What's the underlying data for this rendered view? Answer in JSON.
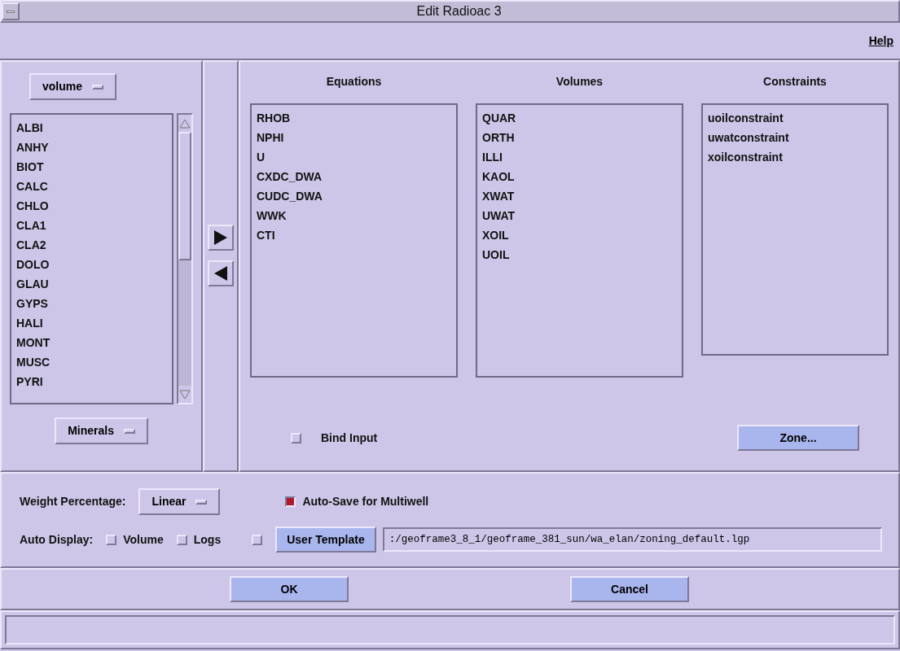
{
  "window": {
    "title": "Edit Radioac 3"
  },
  "menu": [
    {
      "label": "Help"
    }
  ],
  "left": {
    "type_menu": "volume",
    "items": [
      "ALBI",
      "ANHY",
      "BIOT",
      "CALC",
      "CHLO",
      "CLA1",
      "CLA2",
      "DOLO",
      "GLAU",
      "GYPS",
      "HALI",
      "MONT",
      "MUSC",
      "PYRI"
    ],
    "class_menu": "Minerals"
  },
  "transfer_buttons": [
    {
      "kind": "right"
    },
    {
      "kind": "left"
    }
  ],
  "lists": [
    {
      "title": "Equations",
      "items": [
        "RHOB",
        "NPHI",
        "U",
        "CXDC_DWA",
        "CUDC_DWA",
        "WWK",
        "CTI"
      ]
    },
    {
      "title": "Volumes",
      "items": [
        "QUAR",
        "ORTH",
        "ILLI",
        "KAOL",
        "XWAT",
        "UWAT",
        "XOIL",
        "UOIL"
      ]
    },
    {
      "title": "Constraints",
      "items": [
        "uoilconstraint",
        "uwatconstraint",
        "xoilconstraint"
      ]
    }
  ],
  "bind_input": {
    "label": "Bind Input",
    "checked": false
  },
  "zone_button": "Zone...",
  "weight": {
    "label": "Weight Percentage:",
    "value": "Linear"
  },
  "auto_save": {
    "label": "Auto-Save for Multiwell",
    "checked": true
  },
  "auto_display": {
    "label": "Auto Display:",
    "options": [
      {
        "label": "Volume",
        "checked": false
      },
      {
        "label": "Logs",
        "checked": false
      }
    ]
  },
  "user_template": {
    "checked": false,
    "button": "User Template",
    "path": ":/geoframe3_8_1/geoframe_381_sun/wa_elan/zoning_default.lgp"
  },
  "buttons": [
    "OK",
    "Cancel"
  ]
}
